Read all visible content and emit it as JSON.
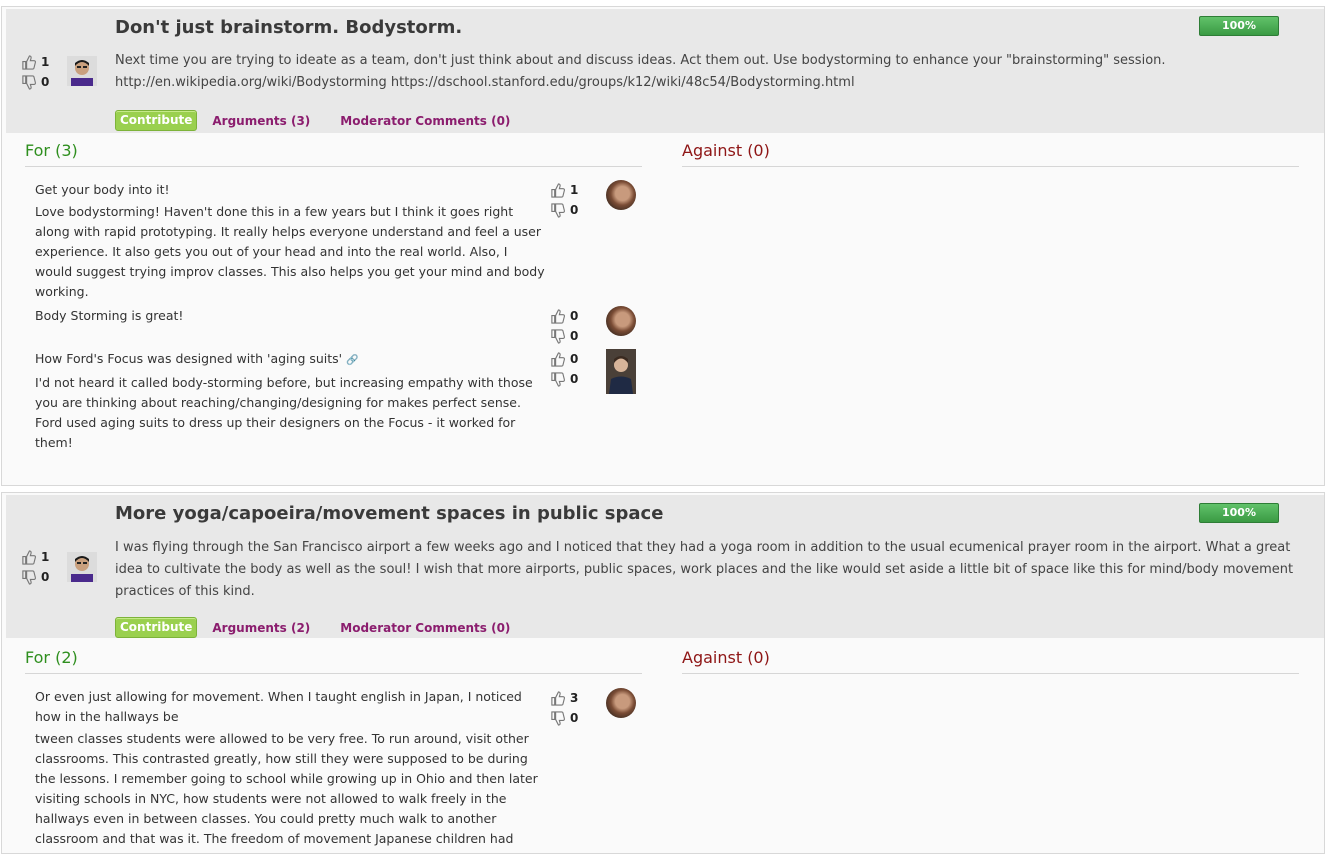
{
  "ideas": [
    {
      "title": "Don't just brainstorm. Bodystorm.",
      "progress": "100%",
      "likes": "1",
      "dislikes": "0",
      "description": "Next time you are trying to ideate as a team, don't just think about and discuss ideas. Act them out. Use bodystorming to enhance your \"brainstorming\" session. http://en.wikipedia.org/wiki/Bodystorming https://dschool.stanford.edu/groups/k12/wiki/48c54/Bodystorming.html",
      "contribute_label": "Contribute",
      "arguments_label": "Arguments (3)",
      "moderator_label": "Moderator Comments (0)",
      "for_heading": "For (3)",
      "against_heading": "Against (0)",
      "arguments": [
        {
          "title": "Get your body into it!",
          "body": "Love bodystorming! Haven't done this in a few years but I think it goes right along with rapid prototyping. It really helps everyone understand and feel a user experience. It also gets you out of your head and into the real world. Also, I would suggest trying improv classes. This also helps you get your mind and body working.",
          "likes": "1",
          "dislikes": "0"
        },
        {
          "title": "Body Storming is great!",
          "body": "",
          "likes": "0",
          "dislikes": "0"
        },
        {
          "title": "How Ford's Focus was designed with 'aging suits'",
          "body": "I'd not heard it called body-storming before, but increasing empathy with those you are thinking about reaching/changing/designing for makes perfect sense. Ford used aging suits to dress up their designers on the Focus - it worked for them!",
          "likes": "0",
          "dislikes": "0"
        }
      ]
    },
    {
      "title": "More yoga/capoeira/movement spaces in public space",
      "progress": "100%",
      "likes": "1",
      "dislikes": "0",
      "description": "I was flying through the San Francisco airport a few weeks ago and I noticed that they had a yoga room in addition to the usual ecumenical prayer room in the airport. What a great idea to cultivate the body as well as the soul! I wish that more airports, public spaces, work places and the like would set aside a little bit of space like this for mind/body movement practices of this kind.",
      "contribute_label": "Contribute",
      "arguments_label": "Arguments (2)",
      "moderator_label": "Moderator Comments (0)",
      "for_heading": "For (2)",
      "against_heading": "Against (0)",
      "arguments": [
        {
          "title": "Or even just allowing for movement. When I taught english in Japan, I noticed how in the hallways be",
          "body": "tween classes students were allowed to be very free. To run around, visit other classrooms. This contrasted greatly, how still they were supposed to be during the lessons. I remember going to school while growing up in Ohio and then later visiting schools in NYC, how students were not allowed to walk freely in the hallways even in between classes. You could pretty much walk to another classroom and that was it. The freedom of movement Japanese children had",
          "likes": "3",
          "dislikes": "0"
        }
      ]
    }
  ]
}
